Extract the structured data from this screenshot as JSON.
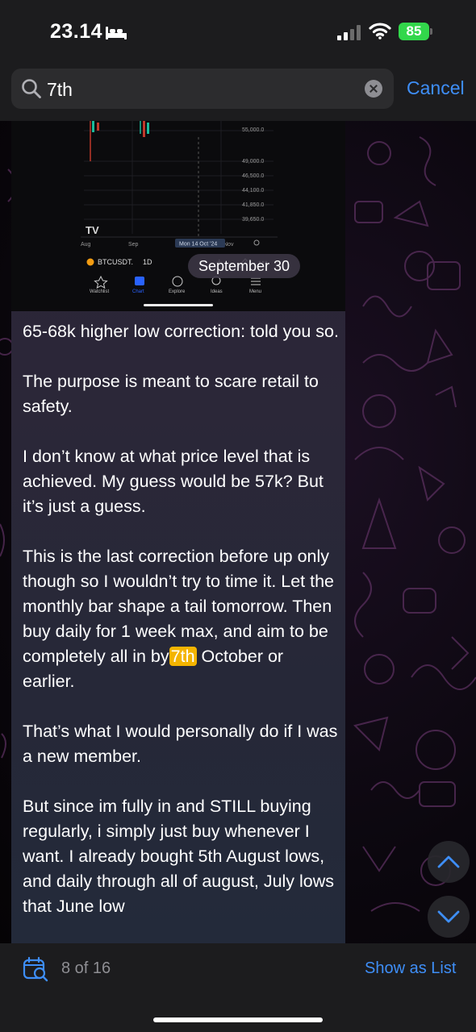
{
  "status_bar": {
    "time": "23.14",
    "battery": "85",
    "icons": [
      "bed-icon",
      "signal-icon",
      "wifi-icon",
      "battery-icon"
    ]
  },
  "search": {
    "query": "7th",
    "cancel_label": "Cancel",
    "icons": [
      "search-icon",
      "clear-icon"
    ]
  },
  "message": {
    "date_pill": "September 30",
    "photo": {
      "price_labels": [
        "55,000.0",
        "49,000.0",
        "46,500.0",
        "44,100.0",
        "41,850.0",
        "39,650.0"
      ],
      "x_labels": [
        "Aug",
        "Sep",
        "Mon 14 Oct '24",
        "Nov"
      ],
      "symbol": "BTCUSDT.",
      "interval": "1D",
      "tabs": [
        "Watchlist",
        "Chart",
        "Explore",
        "Ideas",
        "Menu"
      ],
      "logo": "TV"
    },
    "paragraphs": [
      "65-68k higher low correction: told you so.",
      "The purpose is meant to scare retail to safety.",
      "I don’t know at what price level that is achieved. My guess would be 57k? But it’s just a guess."
    ],
    "para4_before": "This is the last correction before up only though so I wouldn’t try to time it. Let the monthly bar shape a tail tomorrow. Then buy daily for 1 week max, and aim to be completely all in by",
    "para4_highlight": "7th",
    "para4_after": " October or earlier.",
    "paragraphs_after": [
      "That’s what I would personally do if I was a new member.",
      "But since im fully in and STILL buying regularly, i simply just buy whenever I want. I already bought 5th August lows, and daily through all of august, July lows that June low"
    ]
  },
  "bottom_bar": {
    "result_count": "8 of 16",
    "show_as_list_label": "Show as List"
  }
}
